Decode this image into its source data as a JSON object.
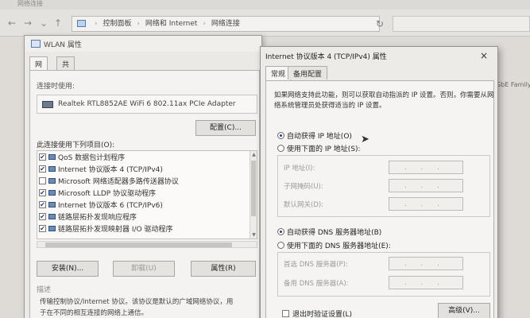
{
  "explorer": {
    "window_title": "网络连接",
    "breadcrumb": [
      "控制面板",
      "网络和 Internet",
      "网络连接"
    ],
    "right_text": "GbE Family"
  },
  "wlan_dialog": {
    "title": "WLAN 属性",
    "tabs": [
      "网络",
      "共享"
    ],
    "connect_using_label": "连接时使用:",
    "adapter_name": "Realtek RTL8852AE WiFi 6 802.11ax PCIe Adapter",
    "configure_button": "配置(C)...",
    "items_label": "此连接使用下列项目(O):",
    "items": [
      {
        "label": "QoS 数据包计划程序",
        "checked": true
      },
      {
        "label": "Internet 协议版本 4 (TCP/IPv4)",
        "checked": true
      },
      {
        "label": "Microsoft 网络适配器多路传送器协议",
        "checked": false
      },
      {
        "label": "Microsoft LLDP 协议驱动程序",
        "checked": true
      },
      {
        "label": "Internet 协议版本 6 (TCP/IPv6)",
        "checked": true
      },
      {
        "label": "链路层拓扑发现响应程序",
        "checked": true
      },
      {
        "label": "链路层拓扑发现映射器 I/O 驱动程序",
        "checked": true
      }
    ],
    "install_button": "安装(N)...",
    "uninstall_button": "卸载(U)",
    "properties_button": "属性(R)",
    "description_label": "描述",
    "description_line1": "传输控制协议/Internet 协议。该协议是默认的广域网络协议，用",
    "description_line2": "于在不同的相互连接的网络上通信。"
  },
  "ipv4_dialog": {
    "title": "Internet 协议版本 4 (TCP/IPv4) 属性",
    "close_glyph": "×",
    "tabs": [
      "常规",
      "备用配置"
    ],
    "intro_line1": "如果网络支持此功能，则可以获取自动指派的 IP 设置。否则，你需要从网",
    "intro_line2": "络系统管理员处获得适当的 IP 设置。",
    "auto_ip": "自动获得 IP 地址(O)",
    "use_ip": "使用下面的 IP 地址(S):",
    "ip_label": "IP 地址(I):",
    "mask_label": "子网掩码(U):",
    "gateway_label": "默认网关(D):",
    "auto_dns": "自动获得 DNS 服务器地址(B)",
    "use_dns": "使用下面的 DNS 服务器地址(E):",
    "pref_dns_label": "首选 DNS 服务器(P):",
    "alt_dns_label": "备用 DNS 服务器(A):",
    "ip_dots": "...",
    "validate_checkbox": "退出时验证设置(L)",
    "advanced_button": "高级(V)..."
  }
}
